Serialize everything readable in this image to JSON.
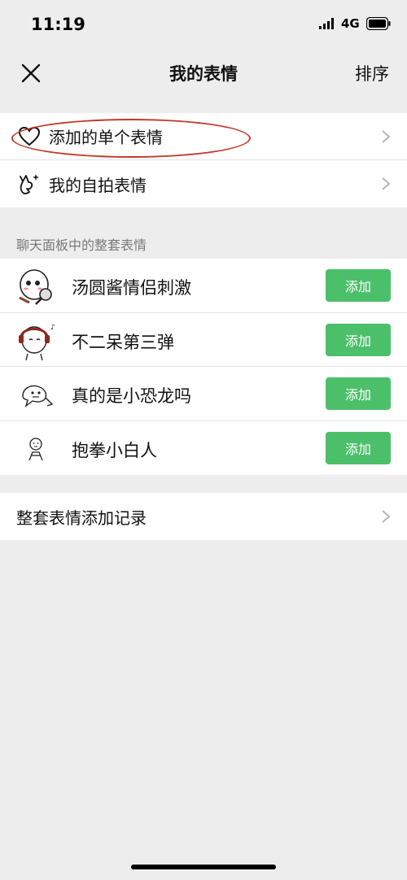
{
  "status": {
    "time": "11:19",
    "network": "4G"
  },
  "nav": {
    "title": "我的表情",
    "sort_label": "排序"
  },
  "top_group": [
    {
      "label": "添加的单个表情",
      "icon": "heart-icon"
    },
    {
      "label": "我的自拍表情",
      "icon": "selfie-hand-icon"
    }
  ],
  "section": {
    "title": "聊天面板中的整套表情"
  },
  "packs": [
    {
      "name": "汤圆酱情侣刺激",
      "button": "添加"
    },
    {
      "name": "不二呆第三弹",
      "button": "添加"
    },
    {
      "name": "真的是小恐龙吗",
      "button": "添加"
    },
    {
      "name": "抱拳小白人",
      "button": "添加"
    }
  ],
  "history": {
    "label": "整套表情添加记录"
  },
  "colors": {
    "accent": "#4cbf6a",
    "annotation": "#c0392b",
    "background": "#ededed"
  }
}
